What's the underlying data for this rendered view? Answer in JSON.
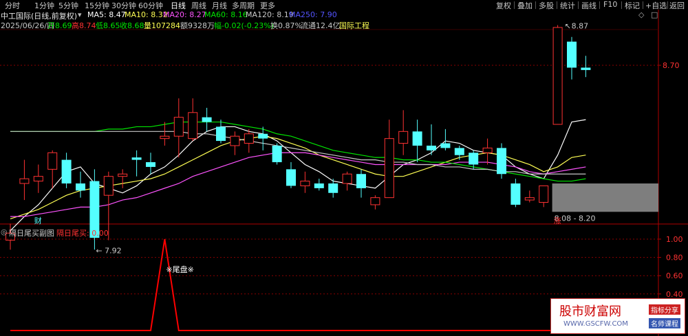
{
  "toolbar": {
    "tabs": [
      "分时",
      "1分钟",
      "5分钟",
      "15分钟",
      "30分钟",
      "60分钟",
      "日线",
      "周线",
      "月线",
      "多周期",
      "更多"
    ],
    "tools": [
      "复权",
      "叠加",
      "多股",
      "统计",
      "画线",
      "F10",
      "标记",
      "+自选",
      "返回"
    ]
  },
  "stock": {
    "name_line": "中工国际(日线,前复权)",
    "date": "2025/06/26/四"
  },
  "ma": {
    "ma5": "MA5: 8.47",
    "ma10": "MA10: 8.32",
    "ma20": "MA20: 8.27",
    "ma60": "MA60: 8.16",
    "ma120": "MA120: 8.19",
    "ma250": "MA250: 7.90"
  },
  "quote": {
    "open": "开8.69",
    "high": "高8.74",
    "low": "低8.65",
    "close": "收8.68",
    "volume": "量107284",
    "amount": "额9328万",
    "change": "幅-0.02(-0.23%)",
    "turnover": "换0.87%",
    "float": "流通12.4亿",
    "sector": "国际工程"
  },
  "indicator": {
    "name": "隔日尾买副图",
    "label": "隔日尾买: 0.00",
    "annotation": "※尾盘※"
  },
  "markers": {
    "cai": "财",
    "zhang": "涨"
  },
  "watermark": {
    "site": "股市财富网",
    "url": "WWW.GSCFW.COM",
    "tag1": "指标分享",
    "tag2": "名师课程"
  },
  "colors": {
    "bg": "#000000",
    "up": "#ff3232",
    "down": "#54ffff",
    "ma5": "#ffffff",
    "ma10": "#ffff54",
    "ma20": "#ff54ff",
    "ma60": "#00e600",
    "ma120": "#c8c8c8",
    "ma250": "#5454ff"
  },
  "chart_data": [
    {
      "type": "candlestick",
      "title": "中工国际(日线,前复权)",
      "y_ticks": [
        8.7
      ],
      "annotations": [
        "8.87",
        "← 7.92",
        "8.08 - 8.20"
      ],
      "candles": [
        {
          "o": 7.96,
          "h": 8.03,
          "l": 7.92,
          "c": 7.99
        },
        {
          "o": 8.2,
          "h": 8.3,
          "l": 8.13,
          "c": 8.22
        },
        {
          "o": 8.21,
          "h": 8.28,
          "l": 8.16,
          "c": 8.23
        },
        {
          "o": 8.26,
          "h": 8.34,
          "l": 8.18,
          "c": 8.33
        },
        {
          "o": 8.3,
          "h": 8.33,
          "l": 8.18,
          "c": 8.2
        },
        {
          "o": 8.2,
          "h": 8.25,
          "l": 8.14,
          "c": 8.17
        },
        {
          "o": 8.21,
          "h": 8.26,
          "l": 7.92,
          "c": 7.97
        },
        {
          "o": 8.15,
          "h": 8.25,
          "l": 7.96,
          "c": 8.23
        },
        {
          "o": 8.23,
          "h": 8.26,
          "l": 8.18,
          "c": 8.24
        },
        {
          "o": 8.31,
          "h": 8.34,
          "l": 8.23,
          "c": 8.3
        },
        {
          "o": 8.29,
          "h": 8.33,
          "l": 8.24,
          "c": 8.27
        },
        {
          "o": 8.39,
          "h": 8.46,
          "l": 8.36,
          "c": 8.4
        },
        {
          "o": 8.4,
          "h": 8.56,
          "l": 8.31,
          "c": 8.48
        },
        {
          "o": 8.39,
          "h": 8.56,
          "l": 8.38,
          "c": 8.5
        },
        {
          "o": 8.48,
          "h": 8.52,
          "l": 8.42,
          "c": 8.46
        },
        {
          "o": 8.44,
          "h": 8.47,
          "l": 8.37,
          "c": 8.38
        },
        {
          "o": 8.36,
          "h": 8.42,
          "l": 8.32,
          "c": 8.4
        },
        {
          "o": 8.37,
          "h": 8.43,
          "l": 8.33,
          "c": 8.41
        },
        {
          "o": 8.41,
          "h": 8.44,
          "l": 8.34,
          "c": 8.39
        },
        {
          "o": 8.36,
          "h": 8.37,
          "l": 8.28,
          "c": 8.29
        },
        {
          "o": 8.26,
          "h": 8.29,
          "l": 8.18,
          "c": 8.19
        },
        {
          "o": 8.19,
          "h": 8.25,
          "l": 8.16,
          "c": 8.21
        },
        {
          "o": 8.2,
          "h": 8.22,
          "l": 8.17,
          "c": 8.18
        },
        {
          "o": 8.2,
          "h": 8.22,
          "l": 8.14,
          "c": 8.16
        },
        {
          "o": 8.2,
          "h": 8.25,
          "l": 8.17,
          "c": 8.24
        },
        {
          "o": 8.24,
          "h": 8.26,
          "l": 8.14,
          "c": 8.18
        },
        {
          "o": 8.11,
          "h": 8.15,
          "l": 8.09,
          "c": 8.14
        },
        {
          "o": 8.14,
          "h": 8.47,
          "l": 8.14,
          "c": 8.39
        },
        {
          "o": 8.37,
          "h": 8.51,
          "l": 8.32,
          "c": 8.42
        },
        {
          "o": 8.42,
          "h": 8.47,
          "l": 8.29,
          "c": 8.36
        },
        {
          "o": 8.36,
          "h": 8.45,
          "l": 8.32,
          "c": 8.34
        },
        {
          "o": 8.37,
          "h": 8.43,
          "l": 8.34,
          "c": 8.35
        },
        {
          "o": 8.35,
          "h": 8.36,
          "l": 8.3,
          "c": 8.32
        },
        {
          "o": 8.33,
          "h": 8.34,
          "l": 8.26,
          "c": 8.28
        },
        {
          "o": 8.33,
          "h": 8.39,
          "l": 8.28,
          "c": 8.35
        },
        {
          "o": 8.35,
          "h": 8.37,
          "l": 8.22,
          "c": 8.24
        },
        {
          "o": 8.2,
          "h": 8.22,
          "l": 8.1,
          "c": 8.11
        },
        {
          "o": 8.13,
          "h": 8.17,
          "l": 8.12,
          "c": 8.14
        },
        {
          "o": 8.12,
          "h": 8.19,
          "l": 8.1,
          "c": 8.19
        },
        {
          "o": 8.45,
          "h": 8.87,
          "l": 8.45,
          "c": 8.86
        },
        {
          "o": 8.8,
          "h": 8.82,
          "l": 8.64,
          "c": 8.69
        },
        {
          "o": 8.69,
          "h": 8.74,
          "l": 8.65,
          "c": 8.68
        }
      ],
      "ma_lines": [
        {
          "name": "MA5",
          "values": [
            8.0,
            8.06,
            8.11,
            8.18,
            8.25,
            8.27,
            8.2,
            8.18,
            8.16,
            8.19,
            8.24,
            8.27,
            8.32,
            8.38,
            8.42,
            8.44,
            8.44,
            8.42,
            8.41,
            8.38,
            8.33,
            8.28,
            8.25,
            8.21,
            8.2,
            8.19,
            8.18,
            8.23,
            8.28,
            8.3,
            8.33,
            8.38,
            8.37,
            8.34,
            8.33,
            8.32,
            8.27,
            8.24,
            8.22,
            8.32,
            8.46,
            8.47
          ]
        },
        {
          "name": "MA10",
          "values": [
            8.05,
            8.07,
            8.09,
            8.12,
            8.15,
            8.17,
            8.18,
            8.19,
            8.2,
            8.21,
            8.22,
            8.24,
            8.27,
            8.3,
            8.33,
            8.36,
            8.38,
            8.39,
            8.4,
            8.39,
            8.37,
            8.35,
            8.32,
            8.3,
            8.28,
            8.26,
            8.24,
            8.23,
            8.23,
            8.25,
            8.27,
            8.29,
            8.31,
            8.32,
            8.33,
            8.32,
            8.3,
            8.28,
            8.25,
            8.27,
            8.31,
            8.32
          ]
        },
        {
          "name": "MA20",
          "values": [
            8.06,
            8.06,
            8.07,
            8.08,
            8.09,
            8.1,
            8.1,
            8.11,
            8.13,
            8.14,
            8.16,
            8.18,
            8.2,
            8.23,
            8.25,
            8.27,
            8.29,
            8.31,
            8.32,
            8.33,
            8.33,
            8.33,
            8.32,
            8.31,
            8.3,
            8.29,
            8.28,
            8.28,
            8.28,
            8.28,
            8.28,
            8.28,
            8.29,
            8.29,
            8.29,
            8.28,
            8.27,
            8.25,
            8.24,
            8.25,
            8.26,
            8.27
          ]
        },
        {
          "name": "MA60",
          "values": [
            8.42,
            8.42,
            8.42,
            8.42,
            8.42,
            8.42,
            8.42,
            8.43,
            8.43,
            8.44,
            8.44,
            8.45,
            8.46,
            8.46,
            8.46,
            8.46,
            8.45,
            8.44,
            8.43,
            8.41,
            8.4,
            8.38,
            8.36,
            8.34,
            8.33,
            8.32,
            8.31,
            8.31,
            8.3,
            8.3,
            8.29,
            8.29,
            8.28,
            8.27,
            8.26,
            8.25,
            8.24,
            8.23,
            8.22,
            8.21,
            8.21,
            8.22
          ]
        },
        {
          "name": "MA120",
          "values": [
            8.42,
            8.42,
            8.42,
            8.42,
            8.42,
            8.42,
            8.42,
            8.42,
            8.42,
            8.42,
            8.42,
            8.42,
            8.42,
            8.41,
            8.41,
            8.4,
            8.39,
            8.38,
            8.37,
            8.36,
            8.35,
            8.34,
            8.33,
            8.32,
            8.31,
            8.3,
            8.3,
            8.29,
            8.29,
            8.28,
            8.28,
            8.27,
            8.27,
            8.26,
            8.26,
            8.25,
            8.25,
            8.24,
            8.24,
            8.24,
            8.24,
            8.24
          ]
        }
      ]
    },
    {
      "type": "line",
      "title": "隔日尾买副图",
      "y_ticks": [
        1.0,
        0.8,
        0.6,
        0.4
      ],
      "ylim": [
        0,
        1.05
      ],
      "values": [
        0,
        0,
        0,
        0,
        0,
        0,
        0,
        0,
        0,
        0,
        0,
        1,
        0,
        0,
        0,
        0,
        0,
        0,
        0,
        0,
        0,
        0,
        0,
        0,
        0,
        0,
        0,
        0,
        0,
        0,
        0,
        0,
        0,
        0,
        0,
        0,
        0,
        0,
        0,
        0,
        0,
        0
      ]
    }
  ]
}
